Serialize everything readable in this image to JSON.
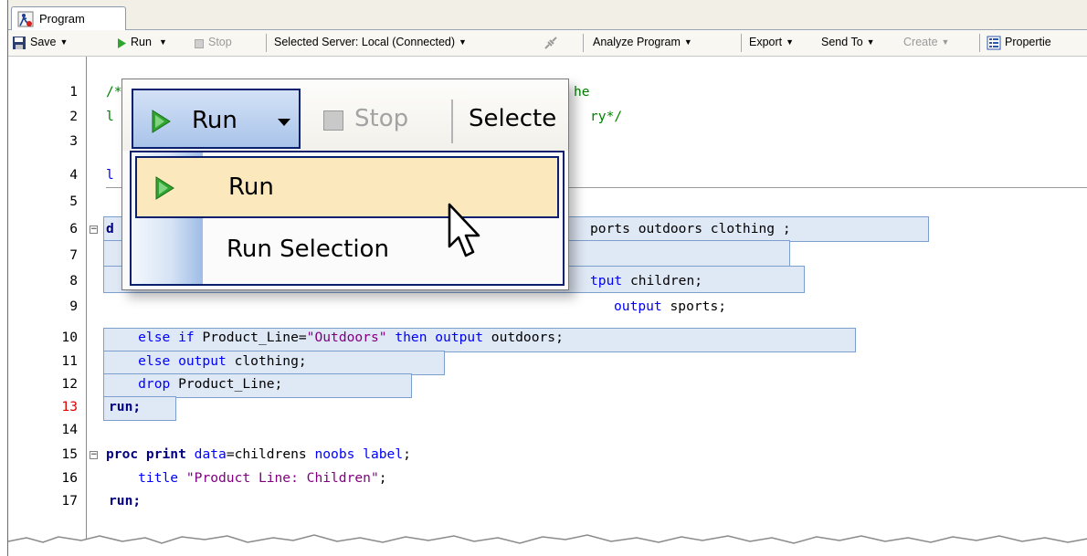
{
  "tab": {
    "label": "Program"
  },
  "toolbar": {
    "save": "Save",
    "run": "Run",
    "stop": "Stop",
    "server": "Selected Server: Local (Connected)",
    "analyze": "Analyze Program",
    "export": "Export",
    "send_to": "Send To",
    "create": "Create",
    "properties": "Propertie"
  },
  "line_numbers": [
    "1",
    "2",
    "3",
    "4",
    "5",
    "6",
    "7",
    "8",
    "9",
    "10",
    "11",
    "12",
    "13",
    "14",
    "15",
    "16",
    "17"
  ],
  "code": {
    "l1": "/*",
    "l1b": "he",
    "l2": "l",
    "l2b": "ry*/",
    "l4": "l",
    "l6a": "d",
    "l6b": "ports outdoors clothing ;",
    "l8a": "tput ",
    "l8b": "children;",
    "l9a": "output ",
    "l9b": "sports;",
    "l10a": "    else if ",
    "l10b": "Product_Line=",
    "l10c": "\"Outdoors\"",
    "l10d": " then output ",
    "l10e": "outdoors;",
    "l11a": "    else output ",
    "l11b": "clothing;",
    "l12a": "    drop ",
    "l12b": "Product_Line;",
    "l13": "run;",
    "l15a": "proc print ",
    "l15b": "data",
    "l15c": "=childrens ",
    "l15d": "noobs label",
    "l15e": ";",
    "l16a": "    title ",
    "l16b": "\"Product Line: Children\"",
    "l16c": ";",
    "l17": "run;"
  },
  "zoom": {
    "run": "Run",
    "stop": "Stop",
    "selected": "Selecte",
    "menu": {
      "run": "Run",
      "run_selection": "Run Selection"
    }
  },
  "colors": {
    "keyword": "#0000ff",
    "string": "#800080",
    "comment": "#008000",
    "error_line_number": "#e00000",
    "selection": "#dfe8f5",
    "menu_highlight": "#fbe8bc",
    "run_icon": "#2fa52f"
  }
}
